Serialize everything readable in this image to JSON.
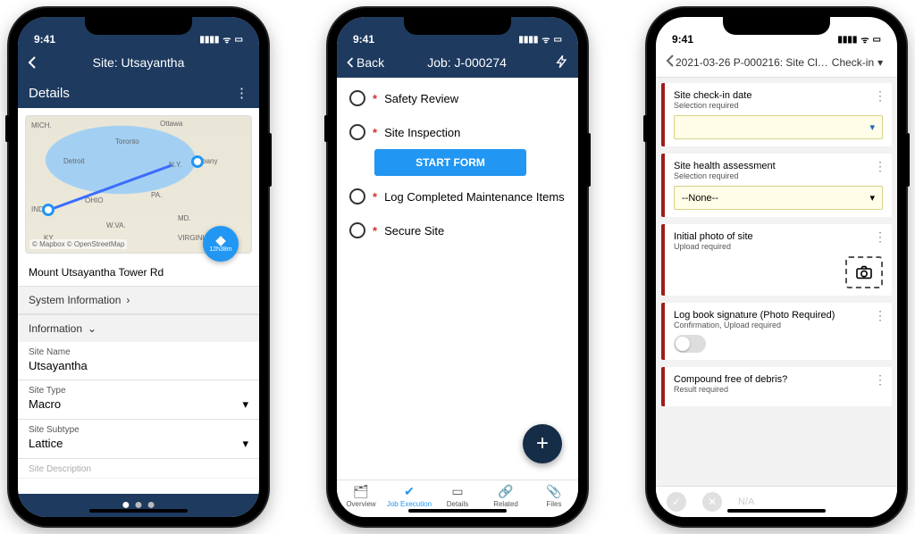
{
  "status_bar": {
    "time": "9:41"
  },
  "phone1": {
    "nav_title": "Site: Utsayantha",
    "section_title": "Details",
    "map": {
      "attribution": "© Mapbox © OpenStreetMap",
      "duration": "12h38m",
      "labels": [
        "MICH.",
        "Ottawa",
        "Toronto",
        "Detroit",
        "N.Y.",
        "Albany",
        "IND.",
        "OHIO",
        "PA.",
        "W.VA.",
        "MD.",
        "VIRGINIA",
        "KY."
      ]
    },
    "address": "Mount Utsayantha Tower Rd",
    "expanders": {
      "system_info": "System Information",
      "information": "Information"
    },
    "fields": {
      "site_name": {
        "label": "Site Name",
        "value": "Utsayantha"
      },
      "site_type": {
        "label": "Site Type",
        "value": "Macro"
      },
      "site_subtype": {
        "label": "Site Subtype",
        "value": "Lattice"
      },
      "site_desc": {
        "label": "Site Description",
        "value": ""
      }
    }
  },
  "phone2": {
    "back_label": "Back",
    "nav_title": "Job: J-000274",
    "tasks": [
      {
        "label": "Safety Review",
        "required": true
      },
      {
        "label": "Site Inspection",
        "required": true,
        "start": true
      },
      {
        "label": "Log Completed Maintenance Items",
        "required": true
      },
      {
        "label": "Secure Site",
        "required": true
      }
    ],
    "start_label": "START FORM",
    "tabs": [
      "Overview",
      "Job Execution",
      "Details",
      "Related",
      "Files"
    ]
  },
  "phone3": {
    "breadcrumb_main": "2021-03-26 P-000216: Site Cl…",
    "breadcrumb_step": "Check-in",
    "cards": {
      "checkin": {
        "title": "Site check-in date",
        "subtitle": "Selection required",
        "select_value": ""
      },
      "health": {
        "title": "Site health assessment",
        "subtitle": "Selection required",
        "select_value": "--None--"
      },
      "photo": {
        "title": "Initial photo of site",
        "subtitle": "Upload required"
      },
      "logbook": {
        "title": "Log book signature (Photo Required)",
        "subtitle": "Confirmation, Upload required"
      },
      "debris": {
        "title": "Compound free of debris?",
        "subtitle": "Result required"
      }
    },
    "result_na": "N/A"
  }
}
